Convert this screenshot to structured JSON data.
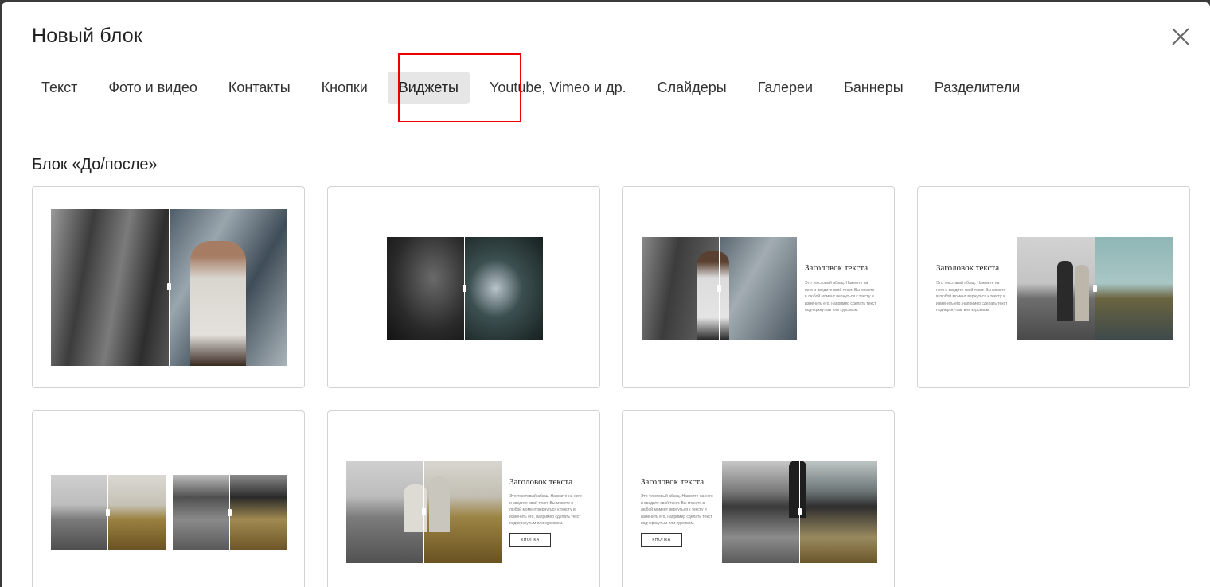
{
  "modal": {
    "title": "Новый блок"
  },
  "tabs": [
    {
      "label": "Текст",
      "active": false
    },
    {
      "label": "Фото и видео",
      "active": false
    },
    {
      "label": "Контакты",
      "active": false
    },
    {
      "label": "Кнопки",
      "active": false
    },
    {
      "label": "Виджеты",
      "active": true
    },
    {
      "label": "Youtube, Vimeo и др.",
      "active": false
    },
    {
      "label": "Слайдеры",
      "active": false
    },
    {
      "label": "Галереи",
      "active": false
    },
    {
      "label": "Баннеры",
      "active": false
    },
    {
      "label": "Разделители",
      "active": false
    }
  ],
  "section": {
    "title": "Блок «До/после»"
  },
  "templates": {
    "heading": "Заголовок текста",
    "paragraph": "Это текстовый абзац. Нажмите на него и введите свой текст. Вы можете в любой момент вернуться к тексту и изменить его, например сделать текст подчеркнутым или курсивом.",
    "button": "КНОПКА"
  },
  "colors": {
    "highlight": "#e00000",
    "active_tab_bg": "#e6e6e6"
  },
  "icons": {
    "close": "close-icon"
  }
}
